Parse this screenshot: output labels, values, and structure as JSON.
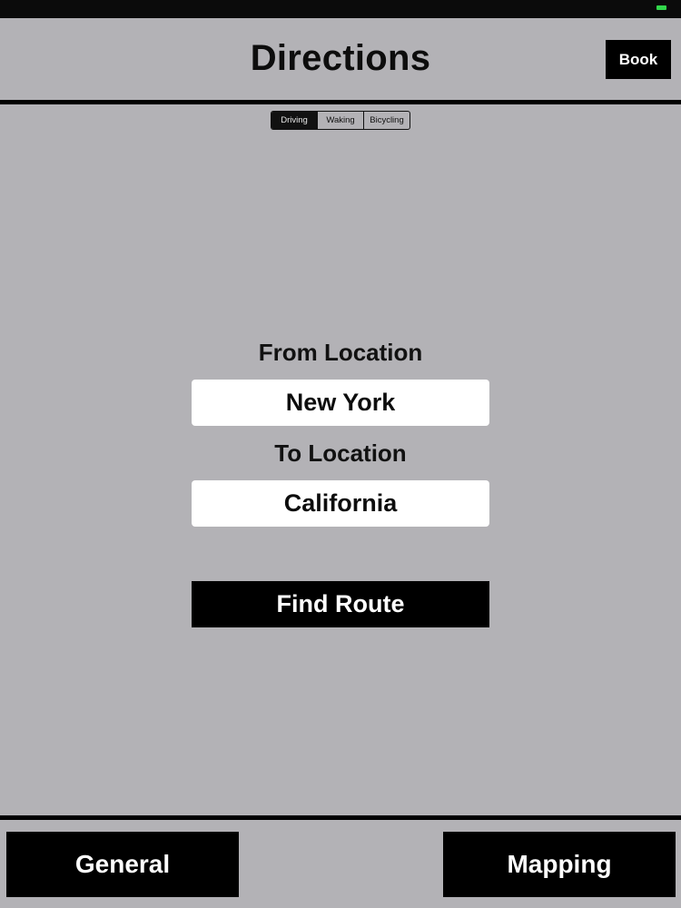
{
  "nav": {
    "title": "Directions",
    "book_label": "Book"
  },
  "travel_mode": {
    "segments": [
      "Driving",
      "Waking",
      "Bicycling"
    ],
    "selected": "Driving"
  },
  "form": {
    "from_label": "From Location",
    "from_value": "New York",
    "to_label": "To Location",
    "to_value": "California",
    "find_route_label": "Find Route"
  },
  "bottom_bar": {
    "general_label": "General",
    "mapping_label": "Mapping"
  },
  "colors": {
    "background": "#b3b2b6",
    "button": "#000000",
    "field": "#ffffff",
    "battery": "#32d74b"
  }
}
